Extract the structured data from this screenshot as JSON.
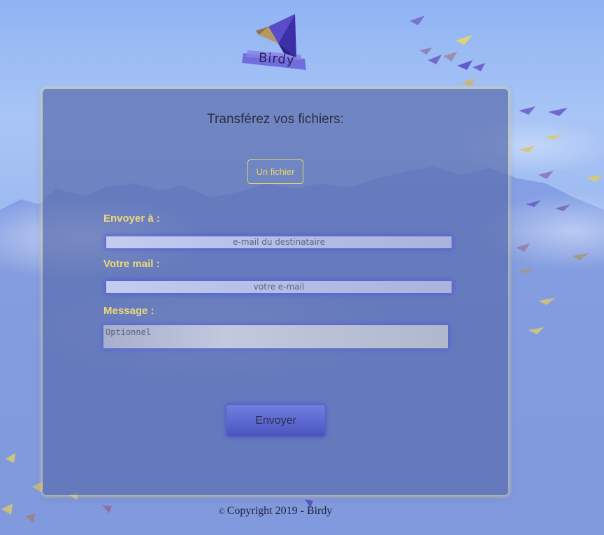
{
  "brand": {
    "name": "Birdy"
  },
  "form": {
    "title": "Transférez vos fichiers:",
    "file_button_label": "Un fichier",
    "recipient_label": "Envoyer à :",
    "recipient_placeholder": "e-mail du destinataire",
    "sender_label": "Votre mail :",
    "sender_placeholder": "votre e-mail",
    "message_label": "Message :",
    "message_placeholder": "Optionnel",
    "submit_label": "Envoyer"
  },
  "footer": {
    "symbol": "©",
    "text": "Copyright 2019 - Birdy"
  },
  "colors": {
    "accent": "#ecd97a",
    "button": "#5a66cf",
    "panel": "#5a6eaf"
  },
  "icons": [
    "origami-bird-logo-icon",
    "origami-bird-flock"
  ]
}
